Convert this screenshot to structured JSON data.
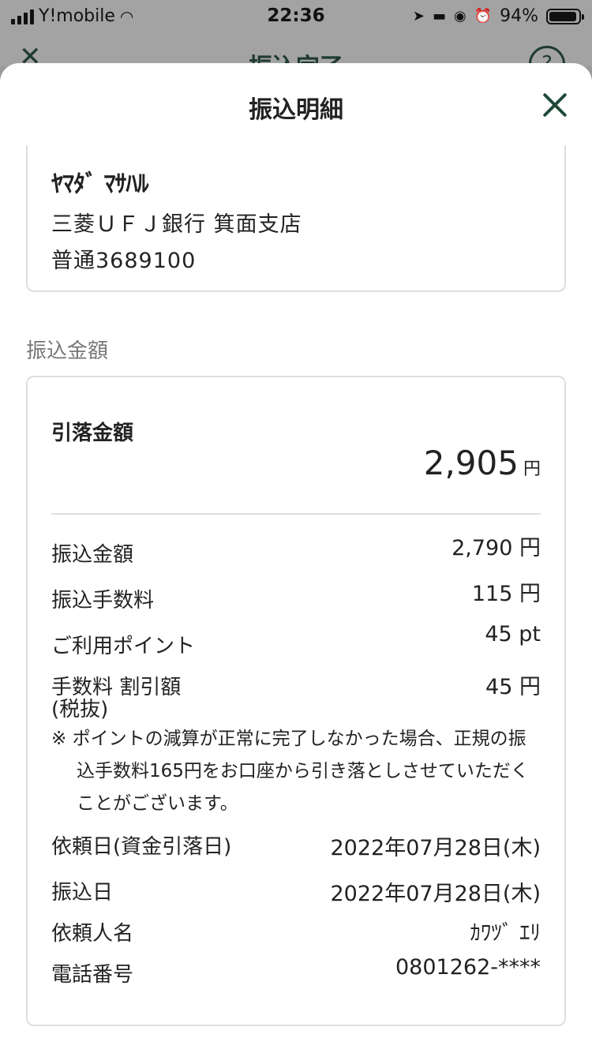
{
  "status_bar": {
    "carrier": "Y!mobile",
    "time": "22:36",
    "battery_percent": "94%"
  },
  "parent_screen": {
    "title": "振込完了",
    "help_label": "?"
  },
  "sheet": {
    "title": "振込明細"
  },
  "recipient": {
    "name": "ﾔﾏﾀﾞ ﾏｻﾊﾙ",
    "bank_branch": "三菱ＵＦＪ銀行 箕面支店",
    "account": "普通3689100"
  },
  "amount_section": {
    "label": "振込金額",
    "debit_label": "引落金額",
    "debit_value": "2,905",
    "debit_unit": "円",
    "rows": [
      {
        "label": "振込金額",
        "value": "2,790 円"
      },
      {
        "label": "振込手数料",
        "value": "115 円"
      },
      {
        "label": "ご利用ポイント",
        "value": "45 pt"
      },
      {
        "label": "手数料 割引額",
        "label2": "(税抜)",
        "value": "45 円"
      }
    ],
    "note": "※ ポイントの減算が正常に完了しなかった場合、正規の振込手数料165円をお口座から引き落としさせていただくことがございます。",
    "details": [
      {
        "label": "依頼日(資金引落日)",
        "value": "2022年07月28日(木)"
      },
      {
        "label": "振込日",
        "value": "2022年07月28日(木)"
      },
      {
        "label": "依頼人名",
        "value": "ｶﾜﾂﾞ ｴﾘ"
      },
      {
        "label": "電話番号",
        "value": "0801262-****"
      }
    ]
  }
}
